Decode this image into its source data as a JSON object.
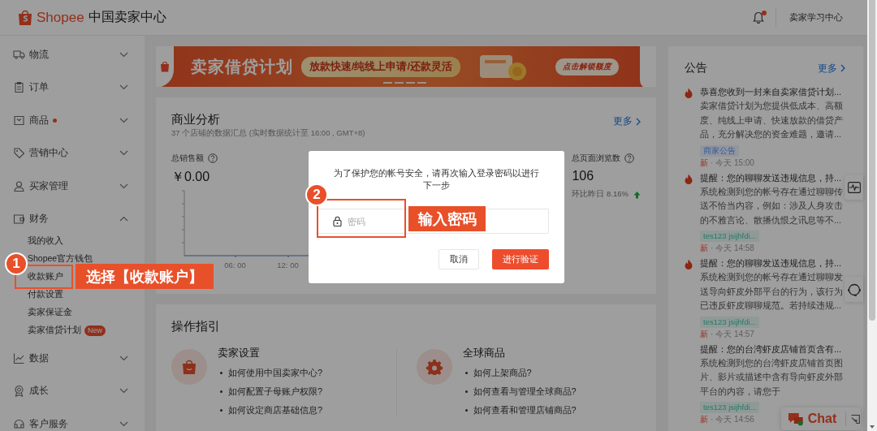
{
  "header": {
    "brand": "Shopee",
    "title": "中国卖家中心",
    "notification_dot": true,
    "link": "卖家学习中心"
  },
  "sidebar": {
    "items": [
      {
        "label": "物流",
        "expanded": false,
        "dot": false
      },
      {
        "label": "订单",
        "expanded": false,
        "dot": false
      },
      {
        "label": "商品",
        "expanded": false,
        "dot": true
      },
      {
        "label": "营销中心",
        "expanded": false,
        "dot": false
      },
      {
        "label": "买家管理",
        "expanded": false,
        "dot": false
      },
      {
        "label": "财务",
        "expanded": true,
        "dot": false,
        "children": [
          {
            "label": "我的收入"
          },
          {
            "label": "Shopee官方钱包"
          },
          {
            "label": "收款账户"
          },
          {
            "label": "付款设置"
          },
          {
            "label": "卖家保证金"
          },
          {
            "label": "卖家借贷计划",
            "badge": "New"
          }
        ]
      },
      {
        "label": "数据",
        "expanded": false,
        "dot": false
      },
      {
        "label": "成长",
        "expanded": false,
        "dot": false
      },
      {
        "label": "客户服务",
        "expanded": false,
        "dot": false
      }
    ]
  },
  "banner": {
    "title": "卖家借贷计划",
    "slogan": "放款快速/纯线上申请/还款灵活",
    "button": "点击解锁额度"
  },
  "analysis": {
    "title": "商业分析",
    "subtitle": "37 个店铺的数据汇总 (实时数据统计至 16:00 , GMT+8)",
    "more": "更多",
    "metrics": [
      {
        "label": "总销售额",
        "value": "￥0.00"
      },
      {
        "label": "总页面浏览数",
        "value": "106",
        "change": "环比昨日 8.16%",
        "rising": true
      }
    ],
    "x_ticks": [
      "06: 00",
      "12: 00"
    ]
  },
  "guide": {
    "title": "操作指引",
    "sections": [
      {
        "kind": "bag",
        "title": "卖家设置",
        "links": [
          "如何使用中国卖家中心?",
          "如何配置子母账户权限?",
          "如何设定商店基础信息?"
        ]
      },
      {
        "kind": "gear",
        "title": "全球商品",
        "links": [
          "如何上架商品?",
          "如何查看与管理全球商品?",
          "如何查看和管理店铺商品?"
        ]
      }
    ]
  },
  "announcements": {
    "title": "公告",
    "more": "更多",
    "items": [
      {
        "hot": true,
        "title": "恭喜您收到一封来自卖家借贷计划...",
        "body": "卖家借贷计划为您提供低成本、高额度、纯线上申请、快速放款的借贷产品，充分解决您的资金难题，邀请...",
        "tag": "商家公告",
        "color": "#36589a",
        "new": "新",
        "time": "· 今天 15:00"
      },
      {
        "hot": true,
        "title": "提醒：您的聊聊发送违规信息，持...",
        "body": "系统检测到您的帐号存在通过聊聊传送不恰当内容，例如：涉及人身攻击的不雅言论、散播仇恨之讯息等不...",
        "tag": "tes123 jsijhfdi...",
        "color": "#257a66",
        "new": "新",
        "time": "· 今天 14:58"
      },
      {
        "hot": true,
        "title": "提醒：您的聊聊发送违规信息，持...",
        "body": "系统检测到您的帐号存在通过聊聊发送导向虾皮外部平台的行为，该行为已违反虾皮聊聊规范。若持续违规...",
        "tag": "tes123 jsijhfdi...",
        "color": "#257a66",
        "new": "新",
        "time": "· 今天 14:57"
      },
      {
        "hot": false,
        "title": "提醒：您的台湾虾皮店铺首页含有...",
        "body": "系统检测到您的台湾虾皮店铺首页图片、影片或描述中含有导向虾皮外部平台的内容，请您于",
        "tag": "tes123 jsijhfdi...",
        "color": "#257a66",
        "new": "新",
        "time": "· 今天 14:56"
      }
    ]
  },
  "chat": {
    "label": "Chat",
    "online": true
  },
  "modal": {
    "message": "为了保护您的帐号安全，请再次输入登录密码以进行下一步",
    "placeholder": "密码",
    "cancel": "取消",
    "confirm": "进行验证"
  },
  "annotations": [
    {
      "number": "1",
      "label": "选择【收款账户】"
    },
    {
      "number": "2",
      "label": "输入密码"
    }
  ]
}
